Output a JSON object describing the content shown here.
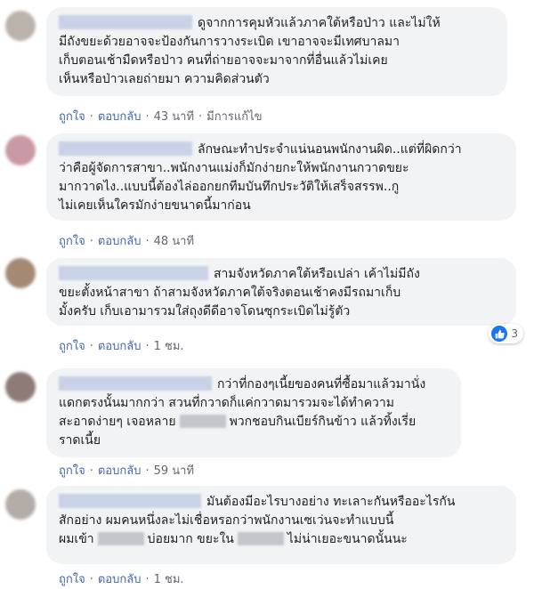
{
  "comments": [
    {
      "avatar_color": "#b9b3ac",
      "lines": [
        {
          "prefix": "",
          "text": "ดูจากการคุมหัวแล้วภาคใต้หรือป่าว และไม่ให้"
        },
        {
          "prefix": "",
          "text": "มีถังขยะด้วยอาจจะป้องกันการวางระเบิด เขาอาจจะมีเทศบาลมา"
        },
        {
          "prefix": "",
          "text": "เก็บตอนเช้ามืดหรือป่าว คนที่ถ่ายอาจจะมาจากที่อื่นแล้วไม่เคย"
        },
        {
          "prefix": "",
          "text": "เห็นหรือป่าวเลยถ่ายมา ความคิดส่วนตัว"
        }
      ],
      "actions": {
        "like": "ถูกใจ",
        "reply": "ตอบกลับ",
        "time": "43 นาที",
        "edited": "มีการแก้ไข"
      }
    },
    {
      "avatar_color": "#c99aa3",
      "lines": [
        {
          "prefix": "",
          "text": "ลักษณะทำประจำแน่นอนพนักงานผิด..แต่ที่ผิดกว่า"
        },
        {
          "prefix": "",
          "text": "ว่าคือผู้จัดการสาขา..พนักงานแม่งก็มักง่ายกะให้พนักงานกวาดขยะ"
        },
        {
          "prefix": "",
          "text": "มากวาดไง..แบบนี้ต้องไล่ออกยกทีมบันทึกประวัติให้เสร็จสรรพ..กู"
        },
        {
          "prefix": "",
          "text": "ไม่เคยเห็นใครมักง่ายขนาดนี้มาก่อน"
        }
      ],
      "actions": {
        "like": "ถูกใจ",
        "reply": "ตอบกลับ",
        "time": "48 นาที",
        "edited": ""
      }
    },
    {
      "avatar_color": "#a48a74",
      "lines": [
        {
          "prefix": "",
          "text": "สามจังหวัดภาคใต้หรือเปล่า เค้าไม่มีถัง"
        },
        {
          "prefix": "",
          "text": "ขยะตั้งหน้าสาขา ถ้าสามจังหวัดภาคใต้จริงตอนเช้าคงมีรถมาเก็บ"
        },
        {
          "prefix": "",
          "text": "มั้งครับ เก็บเอามารวมใส่ถุงดีดีอาจโดนซุกระเบิดไม่รู้ตัว"
        }
      ],
      "actions": {
        "like": "ถูกใจ",
        "reply": "ตอบกลับ",
        "time": "1 ชม.",
        "edited": ""
      },
      "reaction": {
        "icon": "like-icon",
        "count": "3"
      }
    },
    {
      "avatar_color": "#8d7b78",
      "lines": [
        {
          "prefix": "",
          "text": "กว่าที่กองๆเนี้ยของคนที่ซื้อมาแล้วมานั่ง"
        },
        {
          "prefix": "",
          "text": "แดกตรงนั้นมากกว่า สวนที่กวาดก็แค่กวาดมารวมจะได้ทำความ"
        },
        {
          "prefix": "สะอาดง่ายๆ เจอหลาย",
          "text": "พวกชอบกินเบียร์กินข้าว แล้วทิ้งเรี่ย"
        },
        {
          "prefix": "",
          "text": "ราดเนี้ย"
        }
      ],
      "actions": {
        "like": "ถูกใจ",
        "reply": "ตอบกลับ",
        "time": "59 นาที",
        "edited": ""
      }
    },
    {
      "avatar_color": "#b4aca6",
      "lines": [
        {
          "prefix": "",
          "text": "มันต้องมีอะไรบางอย่าง ทะเลาะกันหรืออะไรกัน"
        },
        {
          "prefix": "",
          "text": "สักอย่าง ผมคนหนึ่งละไม่เชื่อหรอกว่าพนักงานเซเว่นจะทำแบบนี้"
        },
        {
          "prefix": "ผมเข้า",
          "text": "บ่อยมาก ขยะใน",
          "suffix": "ไม่น่าเยอะขนาดนั้นนะ"
        }
      ],
      "actions": {
        "like": "ถูกใจ",
        "reply": "ตอบกลับ",
        "time": "1 ชม.",
        "edited": ""
      }
    }
  ]
}
